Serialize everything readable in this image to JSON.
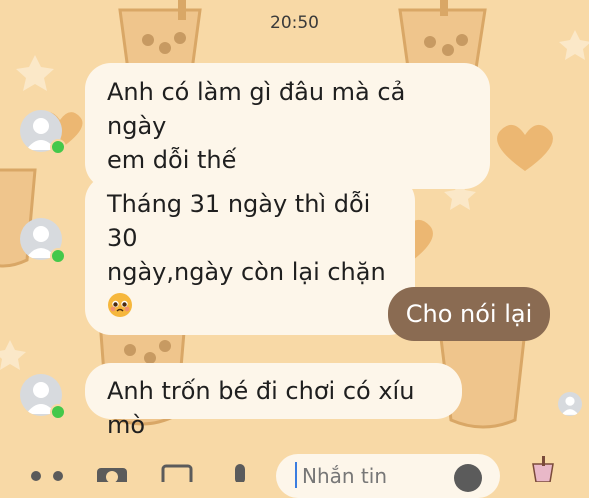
{
  "status_time": "20:50",
  "messages": [
    {
      "sender": "them",
      "lines": [
        "Anh có làm gì đâu mà cả ngày",
        "em dỗi thế"
      ]
    },
    {
      "sender": "them",
      "lines": [
        "Tháng 31 ngày thì dỗi 30",
        "ngày,ngày còn lại chặn"
      ],
      "emoji": "pleading-face"
    },
    {
      "sender": "me",
      "text": "Cho nói lại"
    },
    {
      "sender": "them",
      "lines": [
        "Anh trốn bé đi chơi có xíu mò"
      ]
    }
  ],
  "composer": {
    "placeholder": "Nhắn tin"
  },
  "colors": {
    "background": "#f8d9a6",
    "bubble_in": "#fdf6ea",
    "bubble_out": "#8a6b52",
    "online": "#44c84a"
  }
}
